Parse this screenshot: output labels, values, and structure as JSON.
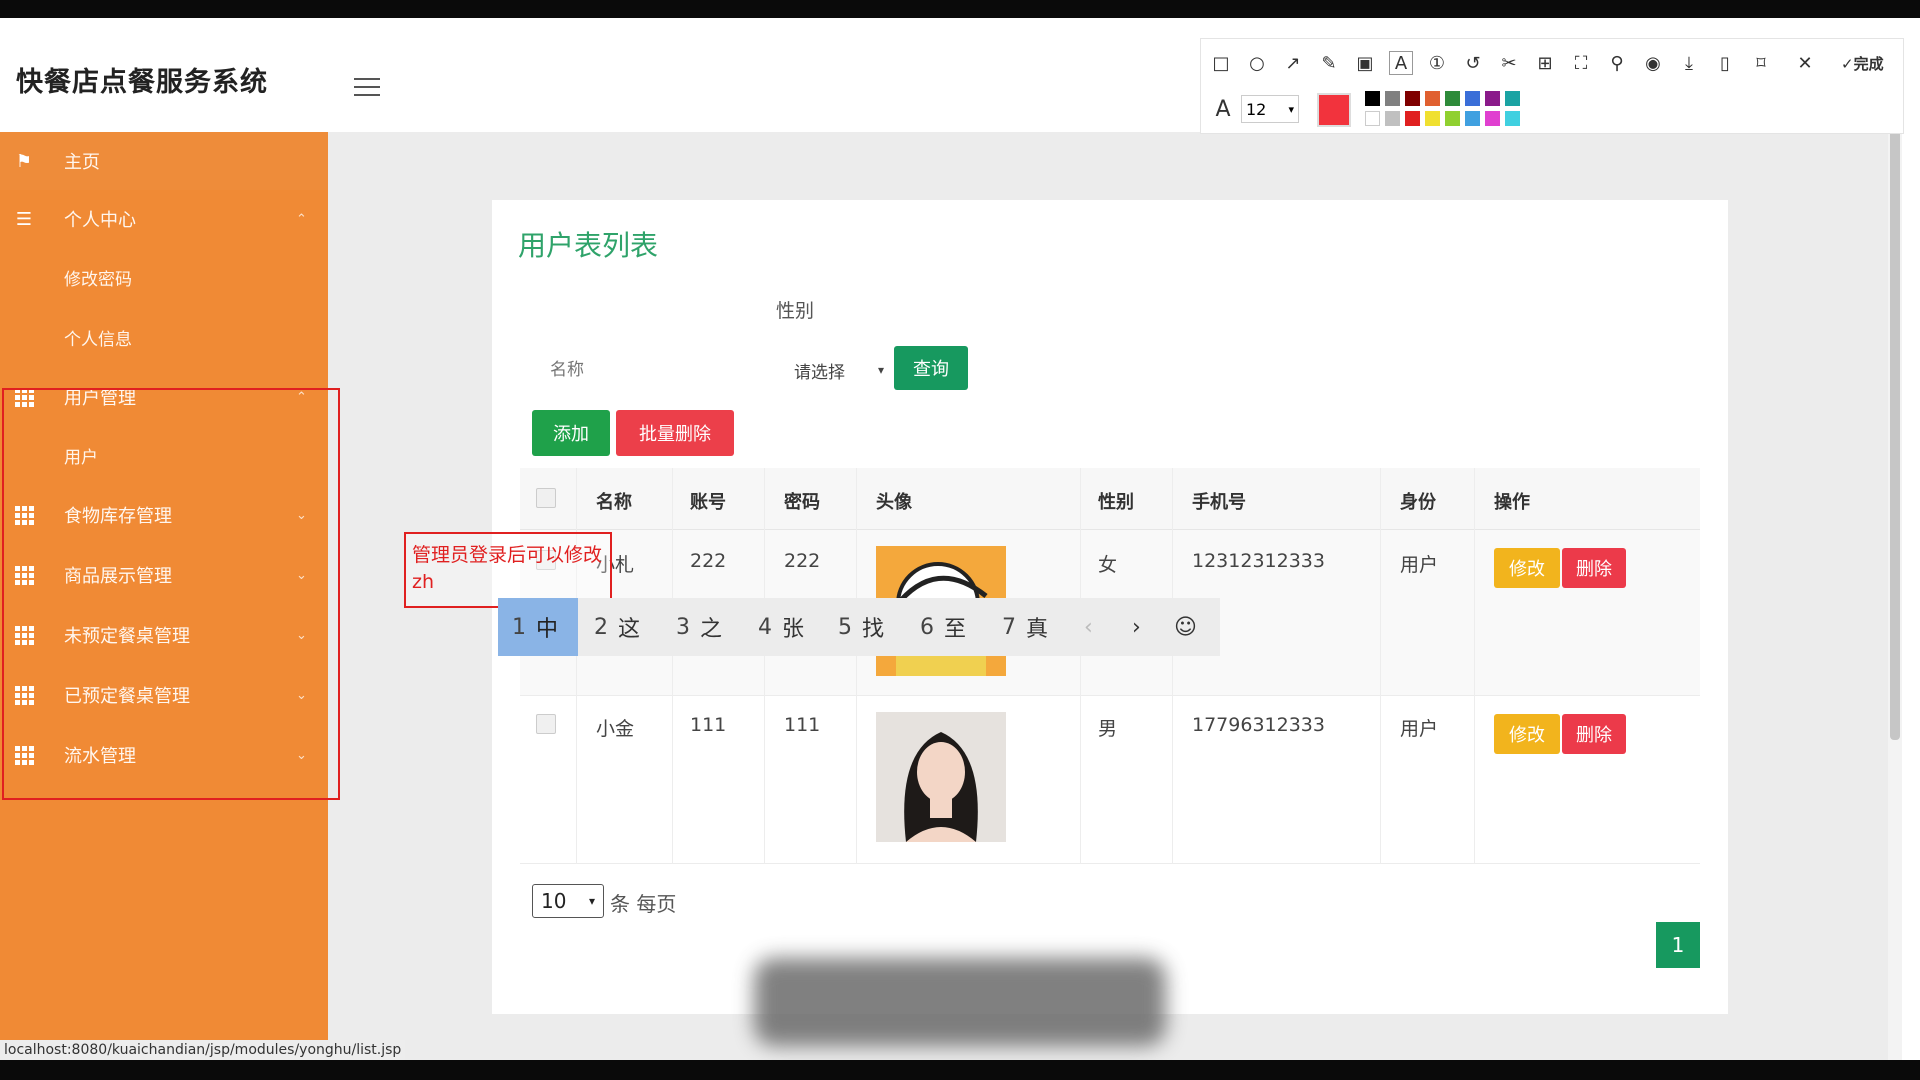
{
  "app": {
    "title": "快餐店点餐服务系统"
  },
  "sidebar": {
    "items": [
      {
        "label": "主页",
        "icon": "flag-icon"
      },
      {
        "label": "个人中心",
        "icon": "list-icon"
      },
      {
        "label": "修改密码"
      },
      {
        "label": "个人信息"
      },
      {
        "label": "用户管理",
        "icon": "grid-icon"
      },
      {
        "label": "用户"
      },
      {
        "label": "食物库存管理",
        "icon": "grid-icon"
      },
      {
        "label": "商品展示管理",
        "icon": "grid-icon"
      },
      {
        "label": "未预定餐桌管理",
        "icon": "grid-icon"
      },
      {
        "label": "已预定餐桌管理",
        "icon": "grid-icon"
      },
      {
        "label": "流水管理",
        "icon": "grid-icon"
      }
    ]
  },
  "main": {
    "title": "用户表列表",
    "filter": {
      "name_placeholder": "名称",
      "gender_label": "性别",
      "gender_value": "请选择",
      "query_label": "查询"
    },
    "actions": {
      "add_label": "添加",
      "batch_delete_label": "批量删除"
    },
    "table": {
      "columns": [
        "名称",
        "账号",
        "密码",
        "头像",
        "性别",
        "手机号",
        "身份",
        "操作"
      ],
      "rows": [
        {
          "name": "小札",
          "account": "222",
          "password": "222",
          "avatar": "cartoon",
          "gender": "女",
          "phone": "12312312333",
          "role": "用户",
          "edit": "修改",
          "delete": "删除"
        },
        {
          "name": "小金",
          "account": "111",
          "password": "111",
          "avatar": "portrait",
          "gender": "男",
          "phone": "17796312333",
          "role": "用户",
          "edit": "修改",
          "delete": "删除"
        }
      ]
    },
    "pagination": {
      "page_size": "10",
      "per_page_text": "条 每页",
      "current_page": "1"
    }
  },
  "annotation": {
    "text": "管理员登录后可以修改zh"
  },
  "ime": {
    "candidates": [
      {
        "num": "1",
        "char": "中"
      },
      {
        "num": "2",
        "char": "这"
      },
      {
        "num": "3",
        "char": "之"
      },
      {
        "num": "4",
        "char": "张"
      },
      {
        "num": "5",
        "char": "找"
      },
      {
        "num": "6",
        "char": "至"
      },
      {
        "num": "7",
        "char": "真"
      }
    ],
    "prev": "‹",
    "next": "›",
    "emoji": "☺"
  },
  "status_bar": {
    "url": "localhost:8080/kuaichandian/jsp/modules/yonghu/list.jsp"
  },
  "screenshot_toolbar": {
    "font_size": "12",
    "done_label": "完成",
    "current_color": "#f2333d",
    "swatches_top": [
      "#000000",
      "#808080",
      "#7f0000",
      "#e06030",
      "#2e8b3a",
      "#3a6ed8",
      "#8a1a8a",
      "#1aa3a3"
    ],
    "swatches_bottom": [
      "#ffffff",
      "#c0c0c0",
      "#e02020",
      "#f0e030",
      "#90d030",
      "#40a0e0",
      "#e040d0",
      "#40d0e0"
    ]
  },
  "colors": {
    "sidebar": "#f08a35",
    "accent_green": "#17995f",
    "danger": "#ec3f4a",
    "warning": "#f2b41d"
  }
}
